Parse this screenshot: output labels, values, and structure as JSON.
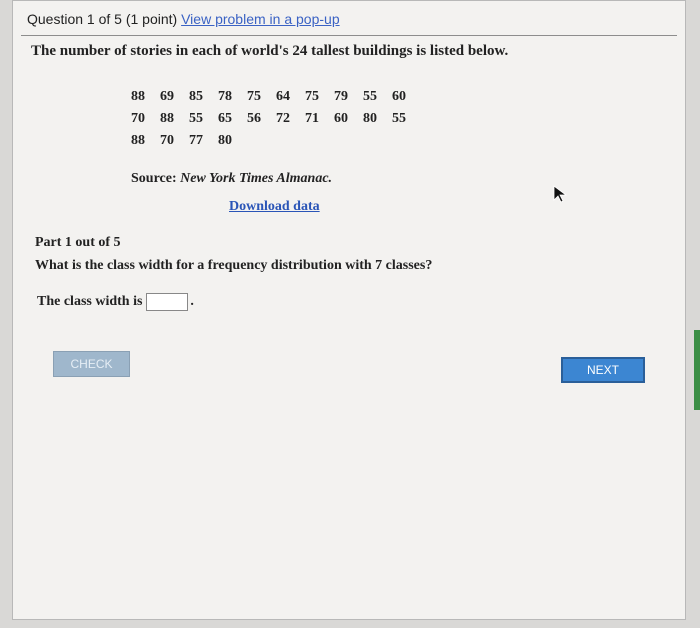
{
  "question": {
    "header": "Question 1 of 5 (1 point)",
    "popup_link": "View problem in a pop-up",
    "prompt": "The number of stories in each of world's 24 tallest buildings is listed below.",
    "data_rows": [
      [
        "88",
        "69",
        "85",
        "78",
        "75",
        "64",
        "75",
        "79",
        "55",
        "60"
      ],
      [
        "70",
        "88",
        "55",
        "65",
        "56",
        "72",
        "71",
        "60",
        "80",
        "55"
      ],
      [
        "88",
        "70",
        "77",
        "80"
      ]
    ],
    "source_label": "Source:",
    "source_publication": "New York Times Almanac.",
    "download_link": "Download data"
  },
  "part": {
    "label": "Part 1 out of 5",
    "question": "What is the class width for a frequency distribution with 7 classes?",
    "answer_prefix": "The class width is",
    "answer_value": "",
    "answer_suffix": "."
  },
  "buttons": {
    "check": "CHECK",
    "next": "NEXT"
  },
  "icons": {
    "cursor": "mouse-pointer-icon"
  }
}
